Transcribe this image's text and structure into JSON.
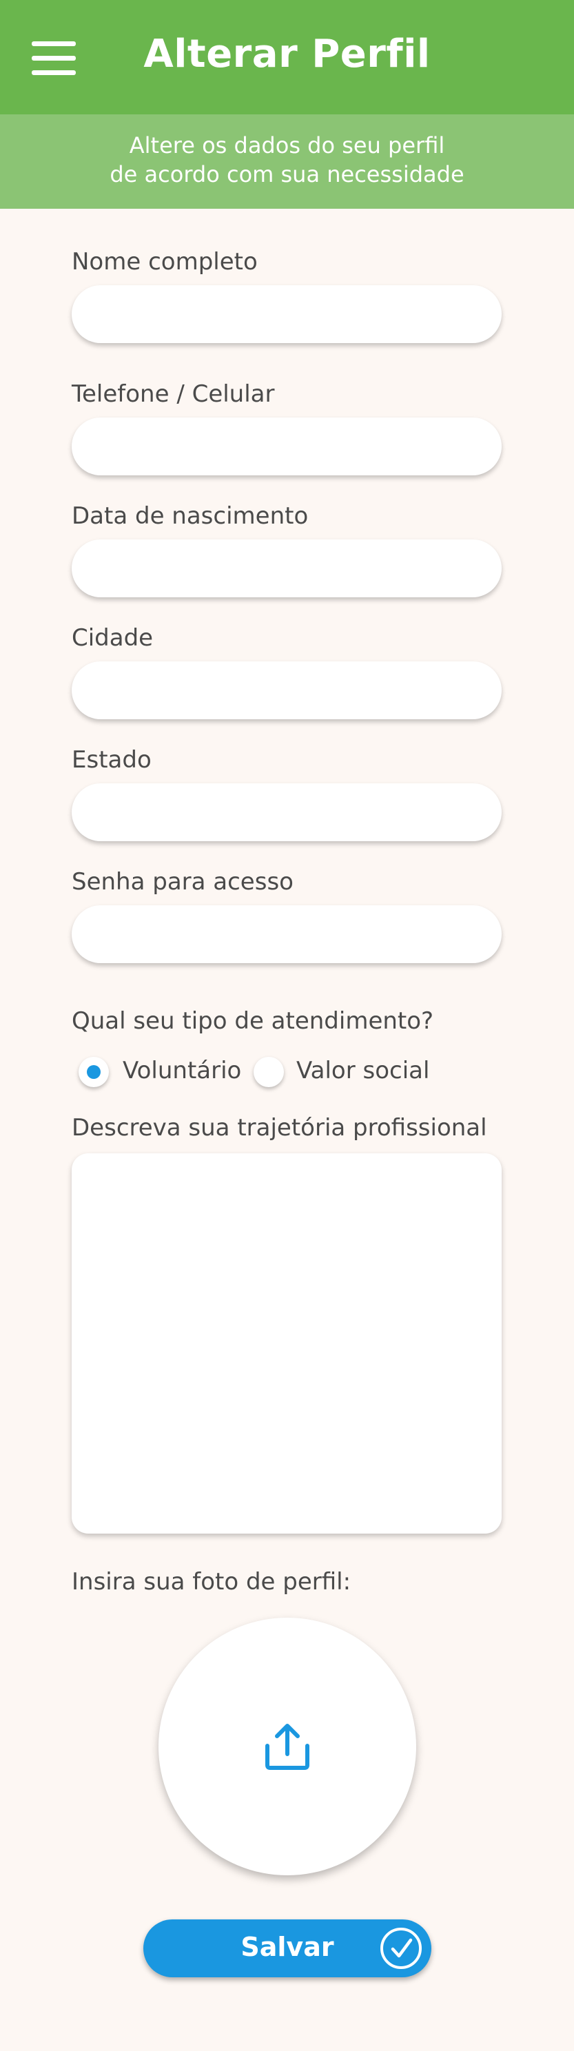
{
  "header": {
    "title": "Alterar Perfil",
    "subtitle_line1": "Altere os dados do seu perfil",
    "subtitle_line2": "de acordo com sua necessidade",
    "menu_icon": "hamburger-menu-icon"
  },
  "form": {
    "fields": [
      {
        "label": "Nome completo",
        "value": ""
      },
      {
        "label": "Telefone / Celular",
        "value": ""
      },
      {
        "label": "Data de nascimento",
        "value": ""
      },
      {
        "label": "Cidade",
        "value": ""
      },
      {
        "label": "Estado",
        "value": ""
      },
      {
        "label": "Senha para acesso",
        "value": ""
      }
    ],
    "attendance": {
      "question": "Qual seu tipo de atendimento?",
      "options": [
        "Voluntário",
        "Valor social"
      ],
      "selected": "Voluntário"
    },
    "career": {
      "label": "Descreva sua trajetória profissional",
      "value": ""
    },
    "photo": {
      "label": "Insira sua foto de perfil:",
      "icon": "upload-icon"
    },
    "save": {
      "label": "Salvar",
      "icon": "check-circle-icon"
    }
  },
  "colors": {
    "header": "#6ab64d",
    "subheader": "#8bc474",
    "background": "#fdf7f3",
    "accent": "#1a97e0"
  }
}
